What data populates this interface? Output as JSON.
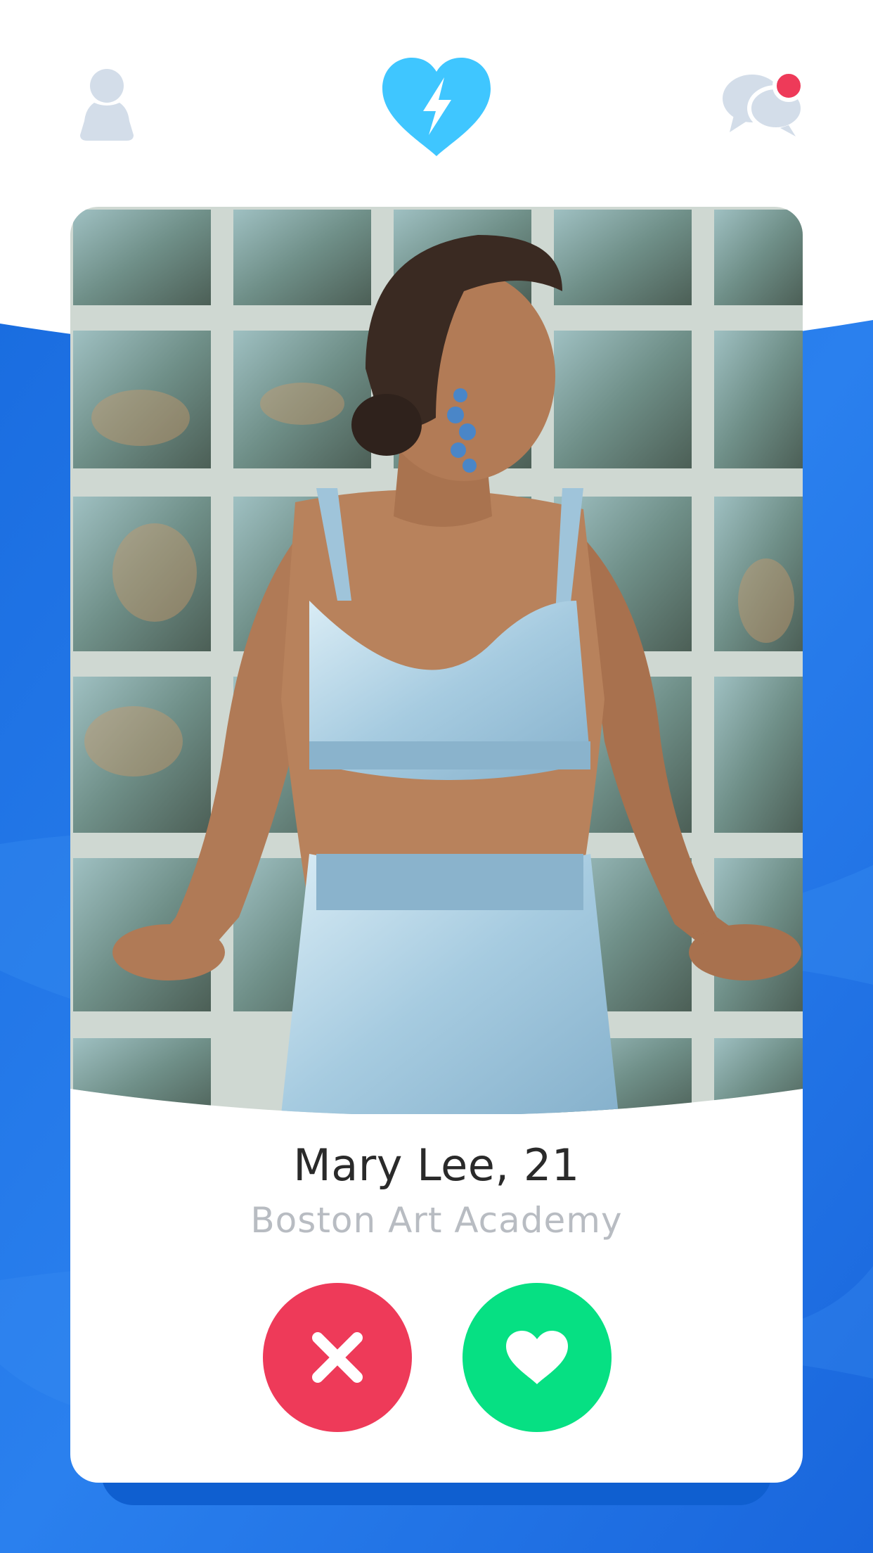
{
  "app": {
    "colors": {
      "brand_blue": "#3fc6ff",
      "background_blue": "#1e74e6",
      "nope_red": "#ee3a59",
      "like_green": "#06e083",
      "notification_dot": "#ee3a59",
      "muted_icon": "#d3dde9"
    }
  },
  "nav": {
    "profile_icon": "person-icon",
    "logo_icon": "lightning-heart-icon",
    "messages_icon": "chat-bubbles-icon",
    "has_notification": true
  },
  "profile": {
    "name_age": "Mary Lee, 21",
    "school": "Boston Art Academy",
    "photo_icon": "profile-photo"
  },
  "actions": {
    "nope_icon": "close-icon",
    "like_icon": "heart-icon"
  }
}
